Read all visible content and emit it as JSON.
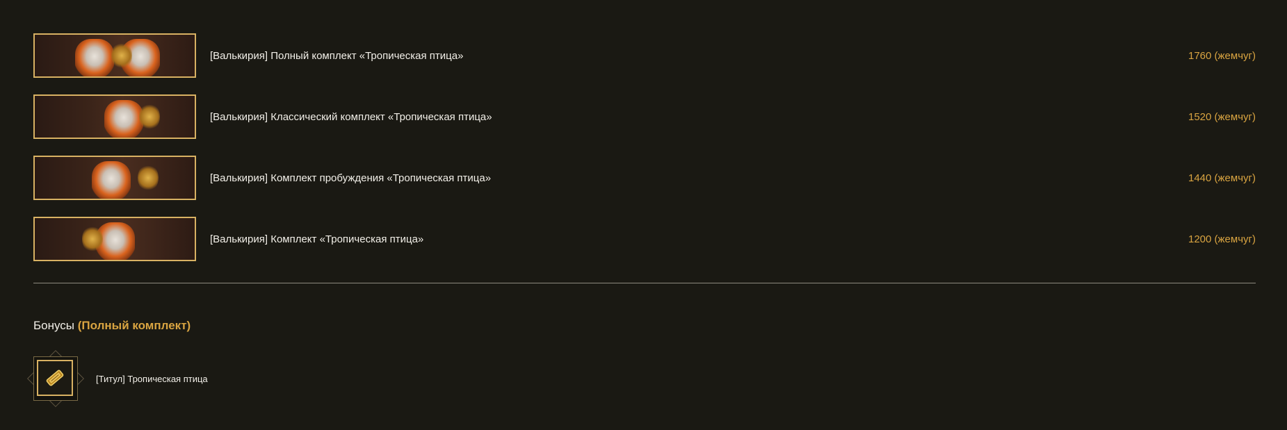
{
  "sets": [
    {
      "name": "[Валькирия] Полный комплект «Тропическая птица»",
      "price": "1760 (жемчуг)"
    },
    {
      "name": "[Валькирия] Классический комплект «Тропическая птица»",
      "price": "1520 (жемчуг)"
    },
    {
      "name": "[Валькирия] Комплект пробуждения «Тропическая птица»",
      "price": "1440 (жемчуг)"
    },
    {
      "name": "[Валькирия] Комплект «Тропическая птица»",
      "price": "1200 (жемчуг)"
    }
  ],
  "bonus": {
    "heading": "Бонусы",
    "heading_accent": "(Полный комплект)",
    "items": [
      {
        "name": "[Титул] Тропическая птица",
        "icon": "title-scroll-icon"
      }
    ]
  },
  "colors": {
    "background": "#1a1913",
    "accent": "#d9a441",
    "frame": "#d9b263",
    "text": "#f2efe8"
  }
}
